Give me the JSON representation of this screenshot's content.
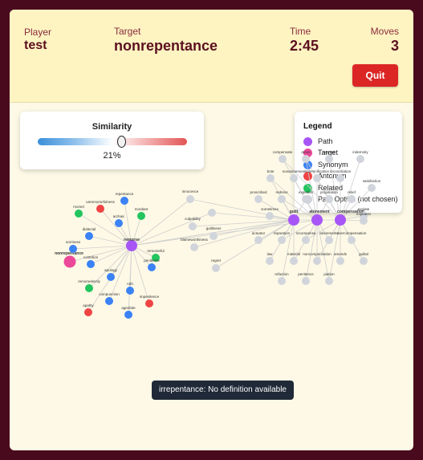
{
  "header": {
    "player_label": "Player",
    "player_value": "test",
    "target_label": "Target",
    "target_value": "nonrepentance",
    "time_label": "Time",
    "time_value": "2:45",
    "moves_label": "Moves",
    "moves_value": "3",
    "quit_label": "Quit"
  },
  "similarity": {
    "title": "Similarity",
    "percent_text": "21%",
    "value": 0.21
  },
  "legend": {
    "title": "Legend",
    "items": [
      {
        "label": "Path",
        "color": "#a855f7"
      },
      {
        "label": "Target",
        "color": "#ec4899"
      },
      {
        "label": "Synonym",
        "color": "#3b82f6"
      },
      {
        "label": "Antonym",
        "color": "#ef4444"
      },
      {
        "label": "Related",
        "color": "#22c55e"
      },
      {
        "label": "Past Option (not chosen)",
        "color": "#d1d5db"
      }
    ]
  },
  "graph": {
    "colors": {
      "path": "#a855f7",
      "target": "#ec4899",
      "synonym": "#3b82f6",
      "antonym": "#ef4444",
      "related": "#22c55e",
      "past": "#d1d5db",
      "edge": "#cfcfcf"
    },
    "nodes": {
      "remorse": {
        "label": "remorse",
        "type": "path",
        "bold": true
      },
      "nonrepentance": {
        "label": "nonrepentance",
        "type": "target",
        "bold": true
      },
      "unremorsefulness": {
        "label": "unremorsefulness",
        "type": "antonym"
      },
      "repentance": {
        "label": "repentance",
        "type": "synonym"
      },
      "morsel": {
        "label": "morsel",
        "type": "related"
      },
      "archaic": {
        "label": "archaic",
        "type": "synonym"
      },
      "mordant": {
        "label": "mordant",
        "type": "related"
      },
      "dialectal": {
        "label": "dialectal",
        "type": "synonym"
      },
      "sorriness": {
        "label": "sorriness",
        "type": "synonym"
      },
      "contrition": {
        "label": "contrition",
        "type": "synonym"
      },
      "remorseful": {
        "label": "remorseful",
        "type": "related"
      },
      "apology": {
        "label": "apology",
        "type": "synonym"
      },
      "penitence": {
        "label": "penitence",
        "type": "synonym"
      },
      "remorselessly": {
        "label": "remorselessly",
        "type": "related"
      },
      "ruth": {
        "label": "ruth",
        "type": "synonym"
      },
      "compunction": {
        "label": "compunction",
        "type": "synonym"
      },
      "impenitence": {
        "label": "impenitence",
        "type": "antonym"
      },
      "apathy": {
        "label": "apathy",
        "type": "antonym"
      },
      "agenbite": {
        "label": "agenbite",
        "type": "synonym"
      },
      "innocence": {
        "label": "innocence",
        "type": "past"
      },
      "uninnocence": {
        "label": "uninnocence",
        "type": "past"
      },
      "culpability": {
        "label": "culpability",
        "type": "past"
      },
      "guiltiness": {
        "label": "guiltiness",
        "type": "past"
      },
      "blameworthiness": {
        "label": "blameworthiness",
        "type": "past"
      },
      "regret": {
        "label": "regret",
        "type": "past"
      },
      "guilt": {
        "label": "guilt",
        "type": "path",
        "bold": true
      },
      "atonement": {
        "label": "atonement",
        "type": "path",
        "bold": true
      },
      "compensation": {
        "label": "compensation",
        "type": "path",
        "bold": true
      },
      "compensate": {
        "label": "compensate",
        "type": "past"
      },
      "atone": {
        "label": "atone",
        "type": "past"
      },
      "requital": {
        "label": "requital",
        "type": "past"
      },
      "indemnity": {
        "label": "indemnity",
        "type": "past"
      },
      "bote": {
        "label": "bote",
        "type": "past"
      },
      "nonatonement": {
        "label": "nonatonement",
        "type": "past"
      },
      "indemnification": {
        "label": "indemnification",
        "type": "past"
      },
      "reconciliation": {
        "label": "reconciliation",
        "type": "past"
      },
      "satisfaction": {
        "label": "satisfaction",
        "type": "past"
      },
      "proscribed": {
        "label": "proscribed",
        "type": "past"
      },
      "redress": {
        "label": "redress",
        "type": "past"
      },
      "expiation": {
        "label": "expiation",
        "type": "past"
      },
      "propitiation": {
        "label": "propitiation",
        "type": "past"
      },
      "relief": {
        "label": "relief",
        "type": "past"
      },
      "sometimes": {
        "label": "sometimes",
        "type": "past"
      },
      "expiate": {
        "label": "expiate",
        "type": "past"
      },
      "explation": {
        "label": "explation",
        "type": "past"
      },
      "actuator": {
        "label": "actuator",
        "type": "past"
      },
      "reparation": {
        "label": "reparation",
        "type": "past"
      },
      "recompense": {
        "label": "recompense",
        "type": "past"
      },
      "atonements": {
        "label": "atonements",
        "type": "past"
      },
      "overcompensation": {
        "label": "overcompensation",
        "type": "past"
      },
      "law": {
        "label": "law",
        "type": "past"
      },
      "material": {
        "label": "material",
        "type": "past"
      },
      "noncompensation": {
        "label": "noncompensation",
        "type": "past"
      },
      "amends": {
        "label": "amends",
        "type": "past"
      },
      "guiltal": {
        "label": "guiltal",
        "type": "past"
      },
      "refaction": {
        "label": "refaction",
        "type": "past"
      },
      "penitence2": {
        "label": "penitence",
        "type": "past"
      },
      "piation": {
        "label": "piation",
        "type": "past"
      }
    },
    "edges": [
      [
        "remorse",
        "unremorsefulness"
      ],
      [
        "remorse",
        "repentance"
      ],
      [
        "remorse",
        "morsel"
      ],
      [
        "remorse",
        "archaic"
      ],
      [
        "remorse",
        "mordant"
      ],
      [
        "remorse",
        "dialectal"
      ],
      [
        "remorse",
        "sorriness"
      ],
      [
        "remorse",
        "contrition"
      ],
      [
        "remorse",
        "remorseful"
      ],
      [
        "remorse",
        "apology"
      ],
      [
        "remorse",
        "penitence"
      ],
      [
        "remorse",
        "remorselessly"
      ],
      [
        "remorse",
        "ruth"
      ],
      [
        "remorse",
        "compunction"
      ],
      [
        "remorse",
        "impenitence"
      ],
      [
        "remorse",
        "apathy"
      ],
      [
        "remorse",
        "agenbite"
      ],
      [
        "remorse",
        "nonrepentance"
      ],
      [
        "remorse",
        "innocence"
      ],
      [
        "remorse",
        "unincence_placeholder"
      ],
      [
        "remorse",
        "guilt"
      ],
      [
        "remorse",
        "atonement"
      ],
      [
        "guilt",
        "innocence"
      ],
      [
        "guilt",
        "unincence_placeholder"
      ],
      [
        "guilt",
        "culpability"
      ],
      [
        "guilt",
        "guiltiness"
      ],
      [
        "guilt",
        "blameworthiness"
      ],
      [
        "guilt",
        "regret"
      ],
      [
        "guilt",
        "proscribed"
      ],
      [
        "guilt",
        "sometimes"
      ],
      [
        "guilt",
        "actuator"
      ],
      [
        "guilt",
        "law"
      ],
      [
        "guilt",
        "bote"
      ],
      [
        "guilt",
        "redress"
      ],
      [
        "guilt",
        "atonement"
      ],
      [
        "guilt",
        "reparation"
      ],
      [
        "guilt",
        "material"
      ],
      [
        "guilt",
        "refaction"
      ],
      [
        "guilt",
        "remorse"
      ],
      [
        "guilt",
        "expiation"
      ],
      [
        "atonement",
        "compensate"
      ],
      [
        "atonement",
        "atone"
      ],
      [
        "atonement",
        "nonatonement"
      ],
      [
        "atonement",
        "indemnification"
      ],
      [
        "atonement",
        "expiation"
      ],
      [
        "atonement",
        "propitiation"
      ],
      [
        "atonement",
        "redress"
      ],
      [
        "atonement",
        "reparation"
      ],
      [
        "atonement",
        "recompense"
      ],
      [
        "atonement",
        "atonements"
      ],
      [
        "atonement",
        "material"
      ],
      [
        "atonement",
        "noncompensation"
      ],
      [
        "atonement",
        "penitence2"
      ],
      [
        "atonement",
        "piation"
      ],
      [
        "atonement",
        "compensation"
      ],
      [
        "atonement",
        "bote"
      ],
      [
        "compensation",
        "requital"
      ],
      [
        "compensation",
        "indemnity"
      ],
      [
        "compensation",
        "reconciliation"
      ],
      [
        "compensation",
        "satisfaction"
      ],
      [
        "compensation",
        "relief"
      ],
      [
        "compensation",
        "expiate"
      ],
      [
        "compensation",
        "explation"
      ],
      [
        "compensation",
        "overcompensation"
      ],
      [
        "compensation",
        "amends"
      ],
      [
        "compensation",
        "guiltal"
      ],
      [
        "compensation",
        "recompense"
      ],
      [
        "compensation",
        "noncompensation"
      ],
      [
        "compensation",
        "indemnification"
      ],
      [
        "compensation",
        "propitiation"
      ],
      [
        "compensation",
        "atonements"
      ],
      [
        "compensation",
        "piation"
      ],
      [
        "compensation",
        "compensate"
      ],
      [
        "compensation",
        "atone"
      ]
    ]
  },
  "tooltip": {
    "text": "irrepentance: No definition available"
  }
}
